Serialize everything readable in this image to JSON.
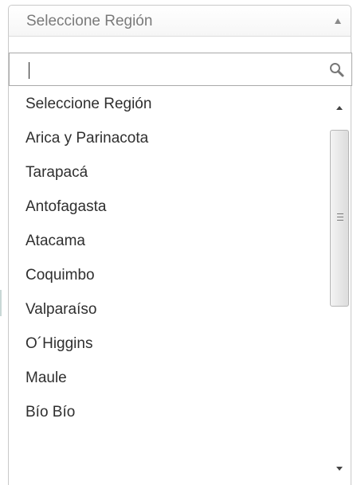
{
  "select": {
    "selected_label": "Seleccione Región"
  },
  "search": {
    "value": "",
    "placeholder": ""
  },
  "options": [
    "Seleccione Región",
    "Arica y Parinacota",
    "Tarapacá",
    "Antofagasta",
    "Atacama",
    "Coquimbo",
    "Valparaíso",
    "O´Higgins",
    "Maule",
    "Bío Bío"
  ],
  "icons": {
    "dropdown": "chevron-up-icon",
    "search": "search-icon",
    "scroll_up": "scroll-up-arrow-icon",
    "scroll_down": "scroll-down-arrow-icon",
    "scroll_grip": "scroll-grip-icon"
  },
  "colors": {
    "border": "#c9c9c9",
    "text": "#2f2f2f",
    "muted_text": "#7a7a7a"
  }
}
